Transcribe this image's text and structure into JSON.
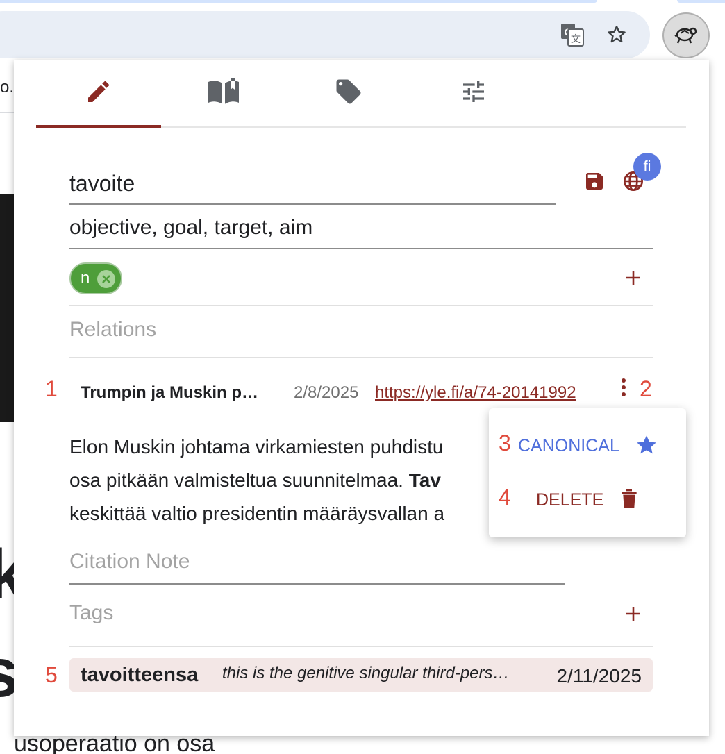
{
  "browser": {
    "toolbar_icons": [
      "translate-icon",
      "star-icon",
      "extension-turtle-icon"
    ]
  },
  "background_page": {
    "fragment_top": "o.",
    "fragment_k": "k",
    "fragment_s": "s",
    "fragment_bottom": "usoperaatio on osa"
  },
  "popup": {
    "tabs": [
      {
        "icon": "edit-icon",
        "active": true
      },
      {
        "icon": "book-icon",
        "active": false
      },
      {
        "icon": "tag-icon",
        "active": false
      },
      {
        "icon": "settings-sliders-icon",
        "active": false
      }
    ],
    "word": "tavoite",
    "language_badge": "fi",
    "translation": "objective, goal, target, aim",
    "pos_chip": "n",
    "relations_placeholder": "Relations",
    "source": {
      "number": "1",
      "title": "Trumpin ja Muskin p…",
      "date": "2/8/2025",
      "url": "https://yle.fi/a/74-20141992",
      "menu_number": "2"
    },
    "context": {
      "line1": "Elon Muskin johtama virkamiesten puhdistu",
      "line2_before": "osa pitkään valmisteltua suunnitelmaa. ",
      "line2_bold": "Tav",
      "line3": "keskittää valtio presidentin määräysvallan a"
    },
    "menu": {
      "canonical_number": "3",
      "canonical_label": "CANONICAL",
      "canonical_color": "#4f6fdc",
      "delete_number": "4",
      "delete_label": "DELETE",
      "delete_color": "#8b2a24"
    },
    "citation_note_placeholder": "Citation Note",
    "tags_placeholder": "Tags",
    "entry": {
      "number": "5",
      "word": "tavoitteensa",
      "note": "this is the genitive singular third-pers…",
      "date": "2/11/2025"
    },
    "accent_color": "#8b2a24",
    "number_color": "#e04a3c"
  }
}
